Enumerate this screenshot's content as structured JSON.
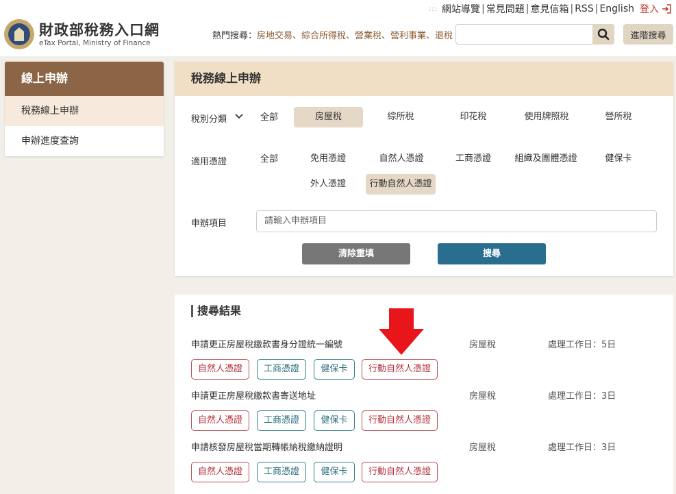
{
  "header": {
    "top_links": [
      "網站導覽",
      "常見問題",
      "意見信箱",
      "RSS",
      "English"
    ],
    "login": "登入",
    "logo_cn": "財政部稅務入口網",
    "logo_en": "eTax Portal, Ministry of Finance",
    "hot_search_label": "熱門搜尋：",
    "hot_search_terms": "房地交易、綜合所得稅、營業稅、營利事業、退稅",
    "search_placeholder": "",
    "advanced_search": "進階搜尋"
  },
  "sidebar": {
    "title": "線上申辦",
    "items": [
      {
        "label": "稅務線上申辦",
        "active": true
      },
      {
        "label": "申辦進度查詢",
        "active": false
      }
    ]
  },
  "form": {
    "title": "稅務線上申辦",
    "tax_type_label": "稅別分類",
    "tax_types": [
      "全部",
      "房屋稅",
      "綜所稅",
      "印花稅",
      "使用牌照稅",
      "營所稅"
    ],
    "tax_type_selected": "房屋稅",
    "cert_label": "適用憑證",
    "certs": [
      "全部",
      "免用憑證",
      "自然人憑證",
      "工商憑證",
      "組織及團體憑證",
      "健保卡",
      "外人憑證",
      "行動自然人憑證"
    ],
    "cert_selected": "行動自然人憑證",
    "item_label": "申辦項目",
    "item_placeholder": "請輸入申辦項目",
    "clear_button": "清除重填",
    "search_button": "搜尋"
  },
  "results": {
    "title": "搜尋結果",
    "items": [
      {
        "name": "申請更正房屋稅繳款書身分證統一編號",
        "category": "房屋稅",
        "days": "處理工作日：5日",
        "tags": [
          "自然人憑證",
          "工商憑證",
          "健保卡",
          "行動自然人憑證"
        ]
      },
      {
        "name": "申請更正房屋稅繳款書寄送地址",
        "category": "房屋稅",
        "days": "處理工作日：3日",
        "tags": [
          "自然人憑證",
          "工商憑證",
          "健保卡",
          "行動自然人憑證"
        ]
      },
      {
        "name": "申請核發房屋稅當期轉帳納稅繳納證明",
        "category": "房屋稅",
        "days": "處理工作日：3日",
        "tags": [
          "自然人憑證",
          "工商憑證",
          "健保卡",
          "行動自然人憑證"
        ]
      }
    ]
  },
  "colors": {
    "sidebar_header": "#8b6545",
    "panel_header": "#f0dfc4",
    "selected_chip": "#e6d8c6",
    "search_button": "#2a6e8f",
    "clear_button": "#777777",
    "tag_red": "#b3323b",
    "tag_teal": "#2a6e7d",
    "annotation_arrow": "#e8151b"
  }
}
